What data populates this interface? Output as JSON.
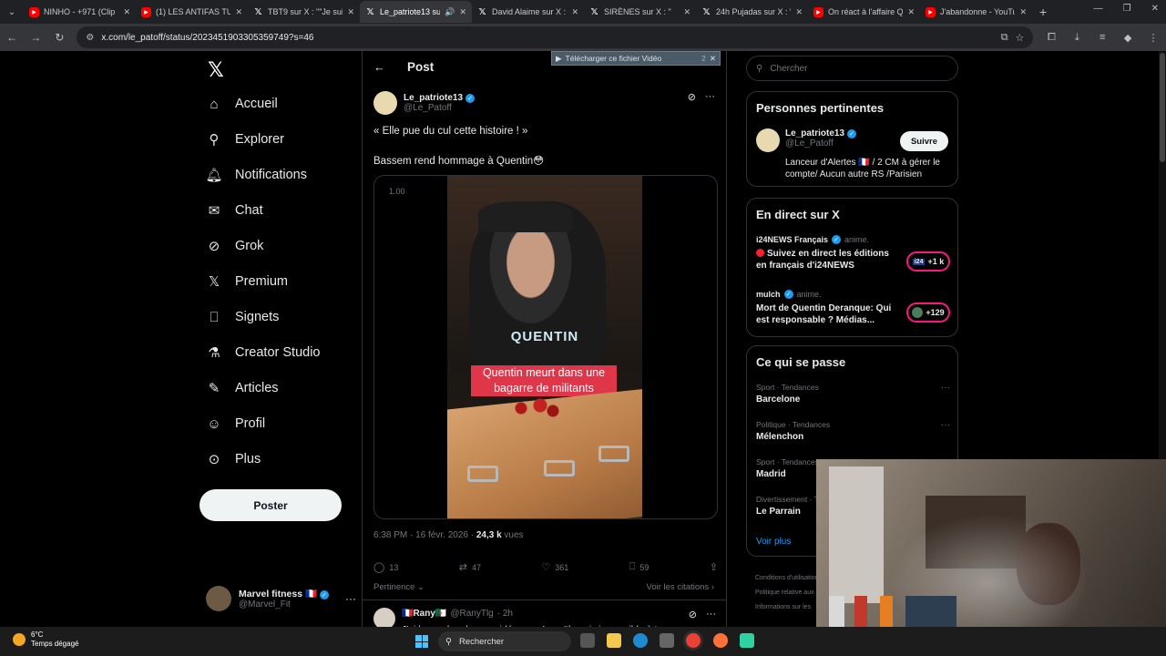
{
  "browser": {
    "tabs": [
      {
        "title": "NINHO - +971 (Clip",
        "fav": "yt",
        "active": false
      },
      {
        "title": "(1) LES ANTIFAS TUE",
        "fav": "yt",
        "active": false
      },
      {
        "title": "TBT9 sur X : \"\"Je suis",
        "fav": "x",
        "active": false
      },
      {
        "title": "Le_patriote13 sur",
        "fav": "x",
        "active": true
      },
      {
        "title": "David Alaime sur X :",
        "fav": "x",
        "active": false
      },
      {
        "title": "SIRÈNES sur X : \"",
        "fav": "x",
        "active": false
      },
      {
        "title": "24h Pujadas sur X : \"",
        "fav": "x",
        "active": false
      },
      {
        "title": "On réact à l'affaire Q",
        "fav": "yt",
        "active": false
      },
      {
        "title": "J'abandonne - YouTu",
        "fav": "yt",
        "active": false
      }
    ],
    "url": "x.com/le_patoff/status/2023451903305359749?s=46"
  },
  "nav": {
    "items": [
      {
        "label": "Accueil",
        "icon": "home-icon"
      },
      {
        "label": "Explorer",
        "icon": "search-icon"
      },
      {
        "label": "Notifications",
        "icon": "bell-icon"
      },
      {
        "label": "Chat",
        "icon": "mail-icon"
      },
      {
        "label": "Grok",
        "icon": "grok-icon"
      },
      {
        "label": "Premium",
        "icon": "x-icon"
      },
      {
        "label": "Signets",
        "icon": "bookmark-icon"
      },
      {
        "label": "Creator Studio",
        "icon": "flask-icon"
      },
      {
        "label": "Articles",
        "icon": "article-icon"
      },
      {
        "label": "Profil",
        "icon": "user-icon"
      },
      {
        "label": "Plus",
        "icon": "more-icon"
      }
    ],
    "post_button": "Poster",
    "account": {
      "name": "Marvel fitness 🇫🇷",
      "handle": "@Marvel_Fit"
    }
  },
  "main": {
    "header_title": "Post",
    "download_banner": "Télécharger ce fichier Vidéo",
    "download_banner_count": "2",
    "tweet": {
      "author": "Le_patriote13",
      "handle": "@Le_Patoff",
      "line1": "« Elle pue du cul cette histoire ! »",
      "line2": "Bassem rend hommage à Quentin😳",
      "video_speed": "1.00",
      "video_shirt_text": "QUENTIN",
      "video_caption": "Quentin meurt dans une bagarre de militants",
      "time": "6:38 PM · 16 févr. 2026 · ",
      "views_count": "24,3 k",
      "views_label": " vues",
      "replies": "13",
      "reposts": "47",
      "likes": "361",
      "bookmarks": "59",
      "sort_label": "Pertinence",
      "quotes_link": "Voir les citations"
    },
    "reply": {
      "name": "🇫🇷Rany🇩🇿",
      "handle": "@RanyTlg",
      "time": "· 2h",
      "text": "J'ai beau chercher sa vidéo pour Ismaël, mais impossible à trouver..."
    }
  },
  "right": {
    "search_placeholder": "Chercher",
    "relevant": {
      "title": "Personnes pertinentes",
      "name": "Le_patriote13",
      "handle": "@Le_Patoff",
      "follow": "Suivre",
      "bio": "Lanceur d'Alertes 🇫🇷 / 2 CM à gérer le compte/ Aucun autre RS /Parisien"
    },
    "live": {
      "title": "En direct sur X",
      "items": [
        {
          "host": "i24NEWS Français",
          "suffix": "anime.",
          "text": "Suivez en direct les éditions en français d'i24NEWS",
          "count": "+1 k",
          "badge": "i24"
        },
        {
          "host": "mulch",
          "suffix": "anime.",
          "text": "Mort de Quentin Deranque: Qui est responsable ? Médias...",
          "count": "+129",
          "badge": ""
        }
      ]
    },
    "trends": {
      "title": "Ce qui se passe",
      "items": [
        {
          "category": "Sport · Tendances",
          "name": "Barcelone"
        },
        {
          "category": "Politique · Tendances",
          "name": "Mélenchon"
        },
        {
          "category": "Sport · Tendances",
          "name": "Madrid"
        },
        {
          "category": "Divertissement · Tendances",
          "name": "Le Parrain"
        }
      ],
      "more": "Voir plus"
    },
    "footer": [
      "Conditions d'utilisation",
      "Politique relative aux",
      "Informations sur les"
    ]
  },
  "taskbar": {
    "temp": "6°C",
    "weather": "Temps dégagé",
    "search": "Rechercher"
  }
}
